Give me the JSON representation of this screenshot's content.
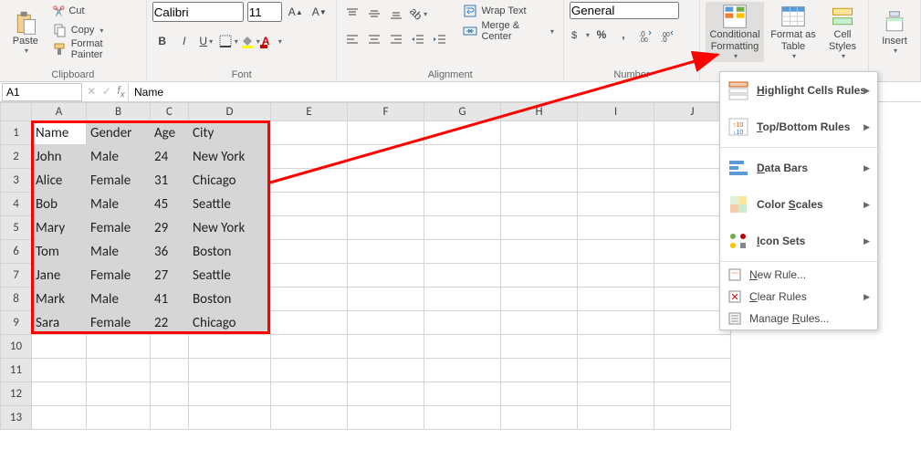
{
  "ribbon": {
    "clipboard": {
      "paste": "Paste",
      "cut": "Cut",
      "copy": "Copy",
      "format_painter": "Format Painter",
      "label": "Clipboard"
    },
    "font": {
      "name": "Calibri",
      "size": "11",
      "label": "Font"
    },
    "alignment": {
      "wrap": "Wrap Text",
      "merge": "Merge & Center",
      "label": "Alignment"
    },
    "number": {
      "format": "General",
      "label": "Number"
    },
    "styles": {
      "cond": "Conditional Formatting",
      "table": "Format as Table",
      "cell": "Cell Styles"
    },
    "insert": "Insert"
  },
  "cf_menu": {
    "highlight": "Highlight Cells Rules",
    "topbottom": "Top/Bottom Rules",
    "databars": "Data Bars",
    "colorscales": "Color Scales",
    "iconsets": "Icon Sets",
    "newrule": "New Rule...",
    "clear": "Clear Rules",
    "manage": "Manage Rules..."
  },
  "namebox": "A1",
  "formula": "Name",
  "columns": [
    "A",
    "B",
    "C",
    "D",
    "E",
    "F",
    "G",
    "H",
    "I",
    "J"
  ],
  "rows": [
    "1",
    "2",
    "3",
    "4",
    "5",
    "6",
    "7",
    "8",
    "9",
    "10",
    "11",
    "12",
    "13"
  ],
  "data": {
    "headers": [
      "Name",
      "Gender",
      "Age",
      "City"
    ],
    "rows": [
      [
        "John",
        "Male",
        "24",
        "New York"
      ],
      [
        "Alice",
        "Female",
        "31",
        "Chicago"
      ],
      [
        "Bob",
        "Male",
        "45",
        "Seattle"
      ],
      [
        "Mary",
        "Female",
        "29",
        "New York"
      ],
      [
        "Tom",
        "Male",
        "36",
        "Boston"
      ],
      [
        "Jane",
        "Female",
        "27",
        "Seattle"
      ],
      [
        "Mark",
        "Male",
        "41",
        "Boston"
      ],
      [
        "Sara",
        "Female",
        "22",
        "Chicago"
      ]
    ]
  }
}
